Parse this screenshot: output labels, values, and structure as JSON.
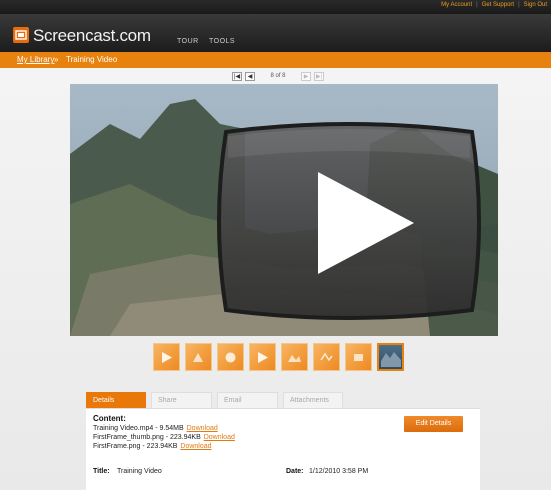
{
  "top_links": [
    "My Account",
    "Get Support",
    "Sign Out"
  ],
  "brand": {
    "name": "Screencast.com"
  },
  "nav": {
    "tour": "TOUR",
    "tools": "TOOLS"
  },
  "breadcrumb": {
    "root": "My Library",
    "separator": "»",
    "current": "Training Video"
  },
  "pager": {
    "first": "|◀",
    "prev": "◀",
    "count": "8 of 8",
    "next": "▶",
    "last": "▶|"
  },
  "media": {
    "thumbnail_count": 8,
    "active_thumbnail": 8,
    "play_icon": "play-icon"
  },
  "tabs": [
    "Details",
    "Share",
    "Email",
    "Attachments"
  ],
  "details": {
    "heading": "Content:",
    "files": [
      {
        "name": "Training Video.mp4 - 9.54MB",
        "link": "Download"
      },
      {
        "name": "FirstFrame_thumb.png - 223.94KB",
        "link": "Download"
      },
      {
        "name": "FirstFrame.png - 223.94KB",
        "link": "Download"
      }
    ],
    "edit_button": "Edit Details",
    "title_label": "Title:",
    "title_value": "Training Video",
    "date_label": "Date:",
    "date_value": "1/12/2010 3:58 PM"
  },
  "colors": {
    "accent": "#e8820e",
    "header": "#222222"
  }
}
